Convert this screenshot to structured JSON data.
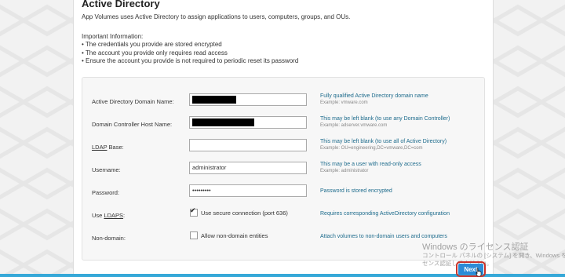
{
  "page": {
    "title": "Active Directory",
    "intro": "App Volumes uses Active Directory to assign applications to users, computers, groups, and OUs.",
    "info_heading": "Important Information:",
    "info_items": [
      "• The credentials you provide are stored encrypted",
      "• The account you provide only requires read access",
      "• Ensure the account you provide is not required to periodic reset its password"
    ]
  },
  "form": {
    "domain": {
      "label": "Active Directory Domain Name:",
      "value": "",
      "help": "Fully qualified Active Directory domain name",
      "example": "Example: vmware.com"
    },
    "dc_host": {
      "label": "Domain Controller Host Name:",
      "value": "",
      "help": "This may be left blank (to use any Domain Controller)",
      "example": "Example: adserver.vmware.com"
    },
    "ldap_base": {
      "label_pre": "",
      "label_u": "LDAP",
      "label_post": " Base:",
      "value": "",
      "help": "This may be left blank (to use all of Active Directory)",
      "example": "Example: OU=engineering,DC=vmware,DC=com"
    },
    "username": {
      "label": "Username:",
      "value": "administrator",
      "help": "This may be a user with read-only access",
      "example": "Example: administrator"
    },
    "password": {
      "label": "Password:",
      "value": "•••••••••",
      "help": "Password is stored encrypted"
    },
    "ldaps": {
      "label_pre": "Use ",
      "label_u": "LDAPS",
      "label_post": ":",
      "checked": true,
      "check_mark": "✔",
      "checkbox_label": "Use secure connection (port 636)",
      "help": "Requires corresponding ActiveDirectory configuration"
    },
    "non_domain": {
      "label": "Non-domain:",
      "checked": false,
      "checkbox_label": "Allow non-domain entities",
      "help": "Attach volumes to non-domain users and computers"
    }
  },
  "actions": {
    "next_label": "Next"
  },
  "watermark": {
    "line1": "Windows のライセンス認証",
    "line2": "コントロール パネルの [システム] を開き、Windows を",
    "line3": "センス認証してください。"
  },
  "colors": {
    "accent": "#2c8bd6",
    "help_text": "#1d6b8c",
    "bottom_bar": "#36a8d8"
  }
}
